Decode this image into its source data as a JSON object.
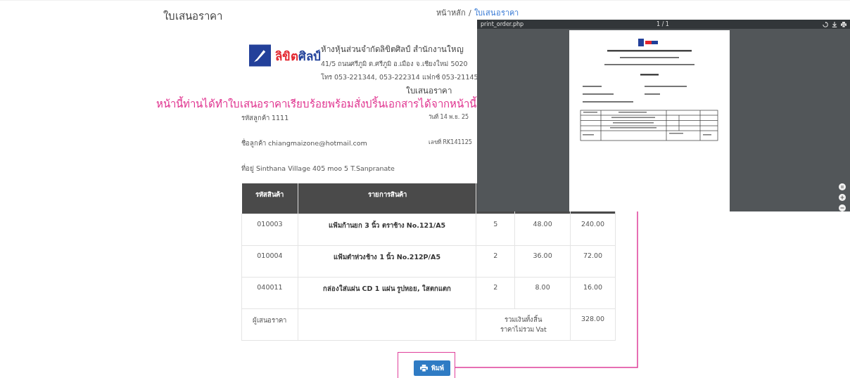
{
  "page_title": "ใบเสนอราคา",
  "breadcrumb": {
    "home": "หน้าหลัก",
    "separator": "/",
    "current": "ใบเสนอราคา"
  },
  "company": {
    "logo_parts": [
      {
        "text": "ลิขิต",
        "color": "#e3262e"
      },
      {
        "text": "ศิลป์",
        "color": "#1f3f99"
      }
    ],
    "lines": [
      "ห้างหุ้นส่วนจำกัดลิขิตศิลป์ สำนักงานใหญ",
      "41/5 ถนนศรีภูมิ ต.ศรีภูมิ อ.เมือง จ.เชียงใหม่ 5020",
      "โทร 053-221344, 053-222314 แฟกซ์ 053-21145"
    ]
  },
  "document_title": "ใบเสนอราคา",
  "annotation": "หน้านี้ท่านได้ทำใบเสนอราคาเรียบร้อยพร้อมสั่งปริ้นเอกสารได้จากหน้านี้",
  "info_rows": [
    {
      "left": "รหัสลูกค้า 1111",
      "right": "วันที่ 14 พ.ย. 25"
    },
    {
      "left": "ชื่อลูกค้า chiangmaizone@hotmail.com",
      "right": "เลขที่ RK141125"
    },
    {
      "left": "ที่อยู่ Sinthana Village 405 moo 5 T.Sanpranate"
    }
  ],
  "table": {
    "columns": [
      "รหัสสินค้า",
      "รายการสินค้า"
    ],
    "rows": [
      [
        "010003",
        "แฟ้มก้านยก 3 นิ้ว ตราช้าง No.121/A5",
        "5",
        "48.00",
        "240.00"
      ],
      [
        "010004",
        "แฟ้มตำห่วงช้าง 1 นิ้ว No.212P/A5",
        "2",
        "36.00",
        "72.00"
      ],
      [
        "040011",
        "กล่องใส่แผ่น CD 1 แผ่น รูปหอย, ใสตกแตก",
        "2",
        "8.00",
        "16.00"
      ]
    ],
    "footer": {
      "signer": "ผู้เสนอราคา",
      "total_label": [
        "รวมเงินทั้งสิ้น",
        "ราคาไม่รวม Vat"
      ],
      "total": "328.00"
    }
  },
  "print_button": "พิมพ์",
  "viewer": {
    "file_name": "print_order.php",
    "page_count": "1 / 1"
  }
}
